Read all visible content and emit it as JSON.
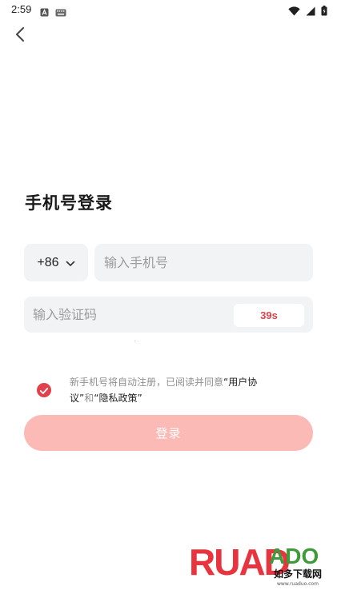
{
  "status_bar": {
    "time": "2:59",
    "left_icons": [
      "notification-a-icon",
      "keyboard-icon"
    ],
    "right_icons": [
      "wifi-icon",
      "signal-icon",
      "battery-icon"
    ]
  },
  "nav": {
    "back_icon": "chevron-left-icon"
  },
  "page": {
    "title": "手机号登录"
  },
  "phone": {
    "country_code": "+86",
    "placeholder": "输入手机号",
    "value": ""
  },
  "verification": {
    "placeholder": "输入验证码",
    "value": "",
    "countdown": "39s"
  },
  "agreement": {
    "checked": true,
    "prefix": "新手机号将自动注册，已阅读并同意",
    "user_agreement": "“用户协议”",
    "conjunction": "和",
    "privacy_policy": "“隐私政策”"
  },
  "login_button": {
    "label": "登录"
  },
  "watermark": {
    "brand_left": "RUAD",
    "brand_right": "ADO",
    "cn_text": "如多下载网",
    "url": "www.ruaduo.com"
  },
  "colors": {
    "accent": "#e0414b",
    "login_button_bg": "#fbbab6",
    "input_bg": "#f2f3f5",
    "placeholder": "#9b9b9b"
  }
}
